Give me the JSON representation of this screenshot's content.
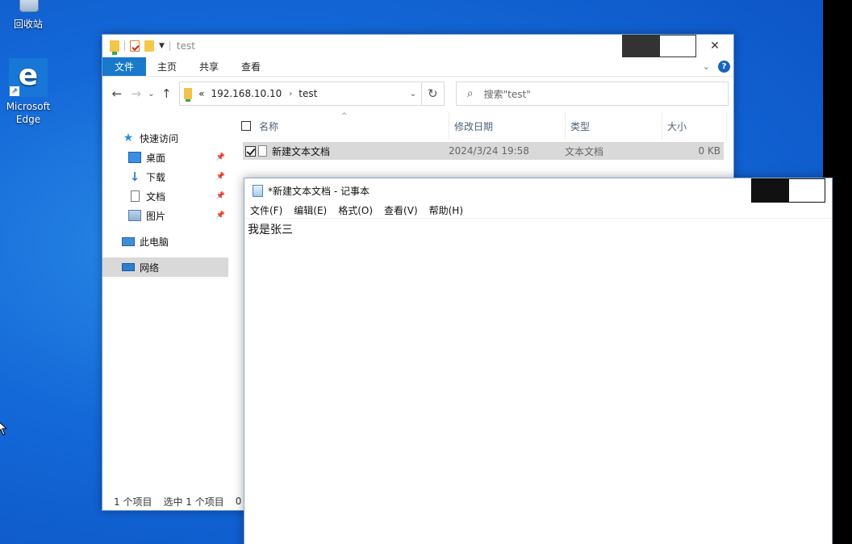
{
  "desktop": {
    "recycle_bin_label": "回收站",
    "edge_label_line1": "Microsoft",
    "edge_label_line2": "Edge"
  },
  "explorer": {
    "title": "test",
    "ribbon_tabs": [
      "文件",
      "主页",
      "共享",
      "查看"
    ],
    "address": {
      "prefix": "«",
      "crumbs": [
        "192.168.10.10",
        "test"
      ]
    },
    "search_placeholder": "搜索\"test\"",
    "nav": {
      "quick_access": "快速访问",
      "desktop": "桌面",
      "downloads": "下载",
      "documents": "文档",
      "pictures": "图片",
      "this_pc": "此电脑",
      "network": "网络"
    },
    "columns": {
      "name": "名称",
      "modified": "修改日期",
      "type": "类型",
      "size": "大小"
    },
    "files": [
      {
        "name": "新建文本文档",
        "modified": "2024/3/24 19:58",
        "type": "文本文档",
        "size": "0 KB",
        "selected": true
      }
    ],
    "status": {
      "count": "1 个项目",
      "selected": "选中 1 个项目",
      "size_frag": "0"
    }
  },
  "notepad": {
    "title": "*新建文本文档 - 记事本",
    "menu": [
      "文件(F)",
      "编辑(E)",
      "格式(O)",
      "查看(V)",
      "帮助(H)"
    ],
    "content": "我是张三"
  },
  "colors": {
    "accent": "#1979ca",
    "desktop_bg": "#1469d8",
    "selection": "#d9d9d9"
  }
}
